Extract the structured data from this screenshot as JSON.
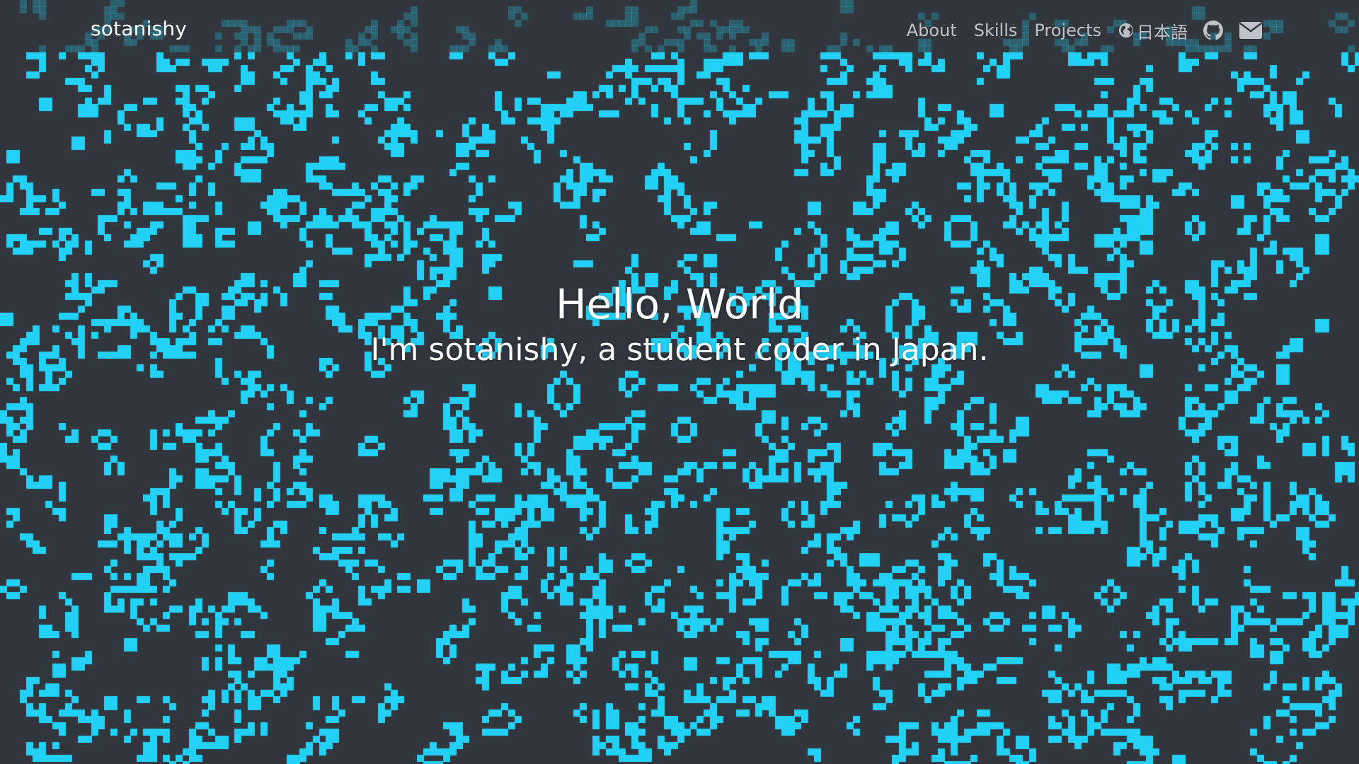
{
  "colors": {
    "background": "#32363d",
    "cell": "#22d1f5",
    "nav_text": "#bfc3c8",
    "text": "#ffffff"
  },
  "navbar": {
    "brand": "sotanishy",
    "links": [
      {
        "label": "About"
      },
      {
        "label": "Skills"
      },
      {
        "label": "Projects"
      }
    ],
    "language_label": "日本語",
    "language_icon": "globe-icon",
    "github_icon": "github-icon",
    "mail_icon": "mail-icon"
  },
  "hero": {
    "title": "Hello, World",
    "subtitle": "I'm sotanishy, a student coder in Japan."
  },
  "background": {
    "type": "game-of-life-grid"
  }
}
